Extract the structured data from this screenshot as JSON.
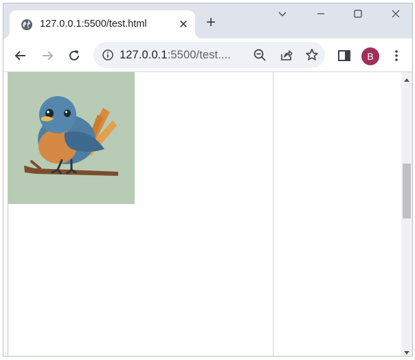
{
  "browser": {
    "tab": {
      "title": "127.0.0.1:5500/test.html",
      "favicon": "globe-icon",
      "close_symbol": "✕"
    },
    "new_tab_symbol": "+",
    "window_controls": [
      "chevron-down-icon",
      "minimize-icon",
      "maximize-icon",
      "close-icon"
    ],
    "toolbar": {
      "back": "back-arrow-icon",
      "forward": "forward-arrow-icon",
      "reload": "reload-icon",
      "site_info": "info-icon",
      "url_host": "127.0.0.1",
      "url_rest": ":5500/test....",
      "zoom": "zoom-out-icon",
      "share": "share-icon",
      "bookmark": "star-icon",
      "side_panel": "side-panel-icon",
      "profile_initial": "B",
      "menu": "more-vert-icon"
    }
  },
  "page": {
    "image": {
      "subject": "bird-illustration"
    }
  },
  "colors": {
    "tabstrip": "#dfe3ec",
    "omnibox": "#eef1f5",
    "avatar": "#a0305a",
    "image_bg": "#b8cbb4"
  }
}
